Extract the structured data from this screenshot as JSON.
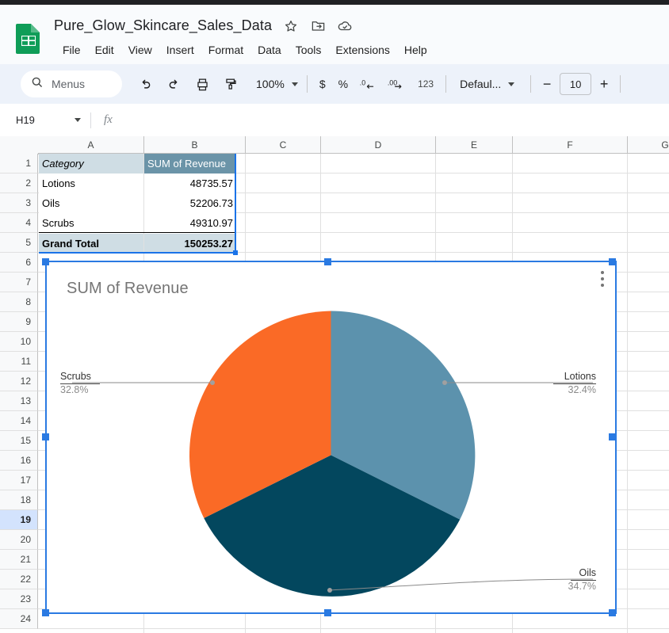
{
  "app": {
    "doc_title": "Pure_Glow_Skincare_Sales_Data",
    "logo_name": "sheets-logo",
    "header_icons": [
      {
        "name": "star-icon",
        "glyph": "☆"
      },
      {
        "name": "move-to-folder-icon",
        "glyph": "◱"
      },
      {
        "name": "cloud-saved-icon",
        "glyph": "☁"
      }
    ],
    "menus": [
      "File",
      "Edit",
      "View",
      "Insert",
      "Format",
      "Data",
      "Tools",
      "Extensions",
      "Help"
    ]
  },
  "toolbar": {
    "search_label": "Menus",
    "search_icon": "search-icon",
    "undo_icon": "undo-icon",
    "redo_icon": "redo-icon",
    "print_icon": "print-icon",
    "paint_icon": "paint-format-icon",
    "zoom_value": "100%",
    "currency_label": "$",
    "percent_label": "%",
    "decrease_decimal_label": ".0",
    "increase_decimal_label": ".00",
    "more_formats_label": "123",
    "font_name": "Defaul...",
    "font_size_decrease": "−",
    "font_size": "10",
    "font_size_increase": "+"
  },
  "formula_bar": {
    "name_box": "H19",
    "fx_label": "fx",
    "formula_value": ""
  },
  "grid": {
    "columns": [
      "A",
      "B",
      "C",
      "D",
      "E",
      "F",
      "G"
    ],
    "rows": [
      "1",
      "2",
      "3",
      "4",
      "5",
      "6",
      "7",
      "8",
      "9",
      "10",
      "11",
      "12",
      "13",
      "14",
      "15",
      "16",
      "17",
      "18",
      "19",
      "20",
      "21",
      "22",
      "23",
      "24"
    ],
    "active_row": "19",
    "pivot": {
      "headers": [
        "Category",
        "SUM of Revenue"
      ],
      "rows": [
        {
          "category": "Lotions",
          "revenue": "48735.57"
        },
        {
          "category": "Oils",
          "revenue": "52206.73"
        },
        {
          "category": "Scrubs",
          "revenue": "49310.97"
        }
      ],
      "total_label": "Grand Total",
      "total_value": "150253.27"
    }
  },
  "chart": {
    "title": "SUM of Revenue",
    "menu_icon": "chart-kebab-menu-icon",
    "selected": true
  },
  "chart_data": {
    "type": "pie",
    "title": "SUM of Revenue",
    "categories": [
      "Lotions",
      "Oils",
      "Scrubs"
    ],
    "values": [
      48735.57,
      52206.73,
      49310.97
    ],
    "percentages": [
      "32.4%",
      "34.7%",
      "32.8%"
    ],
    "colors": [
      "#5c92ad",
      "#03475e",
      "#fa6a26"
    ],
    "total": 150253.27,
    "legend": "none",
    "labels_position": "outside-with-leader-lines",
    "start_angle_deg": 0,
    "direction": "clockwise"
  }
}
